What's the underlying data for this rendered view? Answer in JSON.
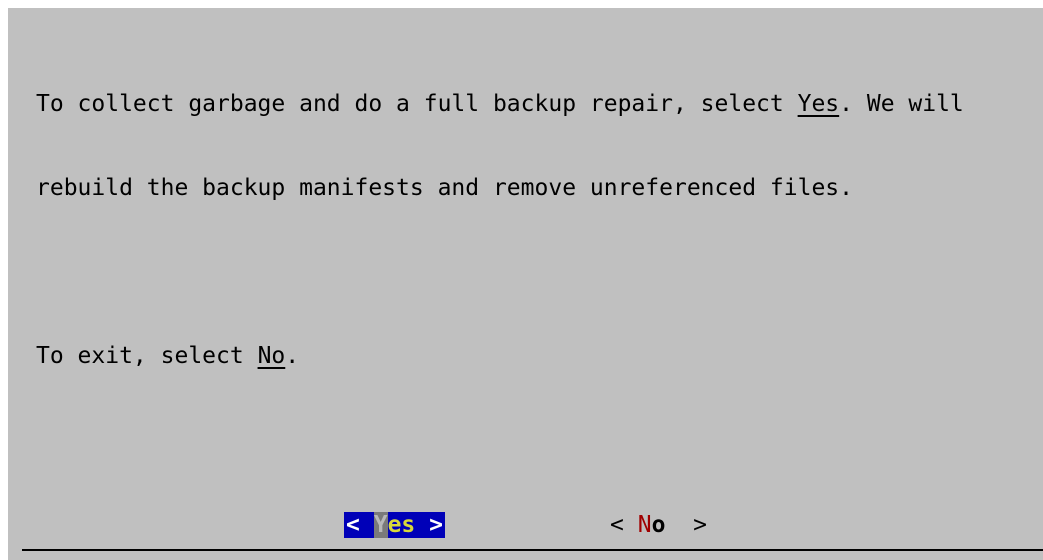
{
  "dialog": {
    "message_line1_before": "To collect garbage and do a full backup repair, select ",
    "message_line1_keyword": "Yes",
    "message_line1_after": ". We will",
    "message_line2": "rebuild the backup manifests and remove unreferenced files.",
    "message_line3_before": "To exit, select ",
    "message_line3_keyword": "No",
    "message_line3_after": "."
  },
  "buttons": {
    "yes": {
      "left_bracket": "<",
      "hotkey": "Y",
      "rest": "es",
      "right_bracket": ">"
    },
    "no": {
      "left_bracket": "<",
      "hotkey": "N",
      "rest": "o",
      "right_bracket": ">"
    }
  },
  "colors": {
    "dialog_background": "#c0c0c0",
    "selected_button_background": "#0000b8",
    "selected_button_text": "#d8d83a",
    "hotkey_red": "#a00000"
  }
}
